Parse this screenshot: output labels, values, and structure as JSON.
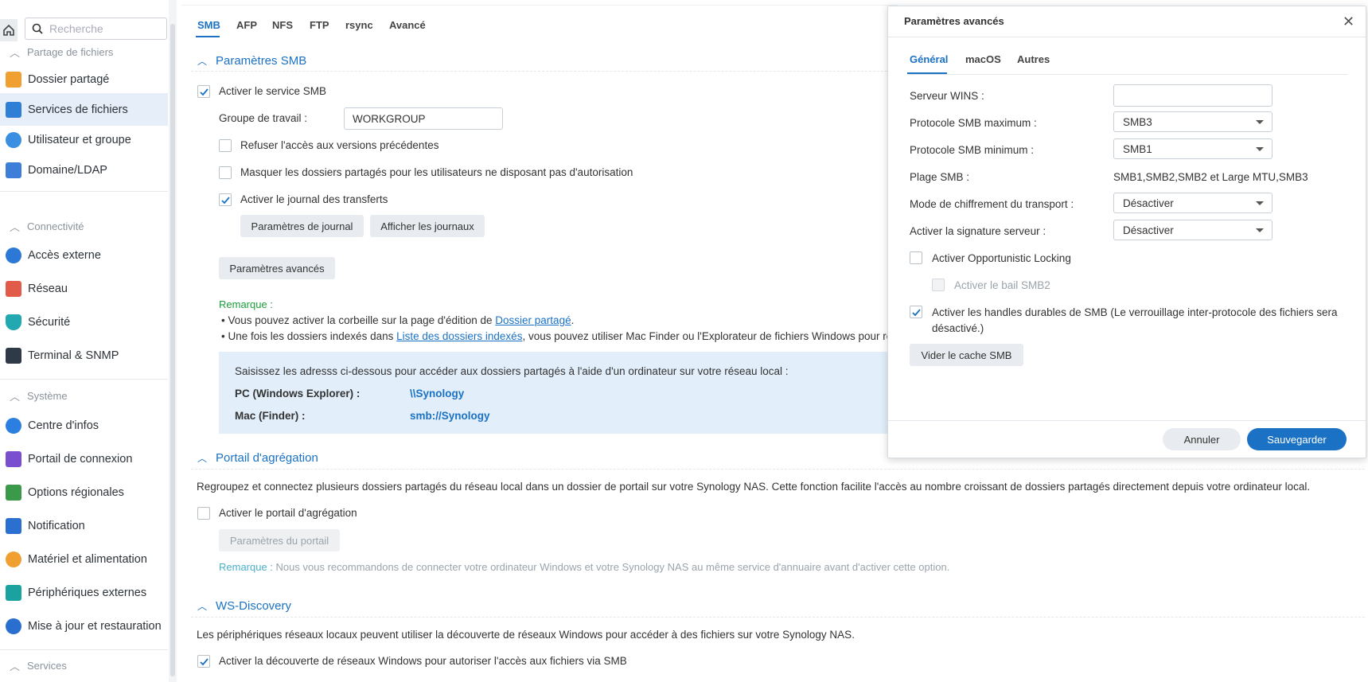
{
  "sidebar": {
    "search_placeholder": "Recherche",
    "sections": {
      "partage": "Partage de fichiers",
      "connectivite": "Connectivité",
      "systeme": "Système",
      "services": "Services"
    },
    "items": [
      {
        "label": "Dossier partagé",
        "icon": "shared-folder-icon",
        "color": "#f0a030"
      },
      {
        "label": "Services de fichiers",
        "icon": "file-services-icon",
        "color": "#2f7fd6"
      },
      {
        "label": "Utilisateur et groupe",
        "icon": "user-group-icon",
        "color": "#3a8fe0"
      },
      {
        "label": "Domaine/LDAP",
        "icon": "domain-ldap-icon",
        "color": "#3f7ed8"
      },
      {
        "label": "Accès externe",
        "icon": "external-access-icon",
        "color": "#2c78d6"
      },
      {
        "label": "Réseau",
        "icon": "network-icon",
        "color": "#e25a4a"
      },
      {
        "label": "Sécurité",
        "icon": "security-shield-icon",
        "color": "#22a8b0"
      },
      {
        "label": "Terminal & SNMP",
        "icon": "terminal-icon",
        "color": "#2f3a49"
      },
      {
        "label": "Centre d'infos",
        "icon": "info-center-icon",
        "color": "#2b7fe0"
      },
      {
        "label": "Portail de connexion",
        "icon": "login-portal-icon",
        "color": "#7a4fcf"
      },
      {
        "label": "Options régionales",
        "icon": "regional-options-icon",
        "color": "#3a9a4a"
      },
      {
        "label": "Notification",
        "icon": "notification-icon",
        "color": "#2b6fd0"
      },
      {
        "label": "Matériel et alimentation",
        "icon": "hardware-power-icon",
        "color": "#f0a030"
      },
      {
        "label": "Périphériques externes",
        "icon": "external-devices-icon",
        "color": "#1aa2a0"
      },
      {
        "label": "Mise à jour et restauration",
        "icon": "update-restore-icon",
        "color": "#2a6fcf"
      }
    ]
  },
  "tabs": [
    "SMB",
    "AFP",
    "NFS",
    "FTP",
    "rsync",
    "Avancé"
  ],
  "smb": {
    "header": "Paramètres SMB",
    "enable_service": "Activer le service SMB",
    "workgroup_label": "Groupe de travail :",
    "workgroup_value": "WORKGROUP",
    "deny_previous": "Refuser l'accès aux versions précédentes",
    "hide_shares": "Masquer les dossiers partagés pour les utilisateurs ne disposant pas d'autorisation",
    "enable_log": "Activer le journal des transferts",
    "log_settings_btn": "Paramètres de journal",
    "view_logs_btn": "Afficher les journaux",
    "advanced_btn": "Paramètres avancés",
    "note_label": "Remarque :",
    "note1_pre": "Vous pouvez activer la corbeille sur la page d'édition de ",
    "note1_link": "Dossier partagé",
    "note1_post": ".",
    "note2_pre": "Une fois les dossiers indexés dans ",
    "note2_link": "Liste des dossiers indexés",
    "note2_post": ", vous pouvez utiliser Mac Finder ou l'Explorateur de fichiers Windows pour reche",
    "info_text": "Saisissez les adresss ci-dessous pour accéder aux dossiers partagés à l'aide d'un ordinateur sur votre réseau local :",
    "pc_label": "PC (Windows Explorer) :",
    "pc_value": "\\\\Synology",
    "mac_label": "Mac (Finder) :",
    "mac_value": "smb://Synology"
  },
  "aggregation": {
    "header": "Portail d'agrégation",
    "description": "Regroupez et connectez plusieurs dossiers partagés du réseau local dans un dossier de portail sur votre Synology NAS. Cette fonction facilite l'accès au nombre croissant de dossiers partagés directement depuis votre ordinateur local.",
    "enable": "Activer le portail d'agrégation",
    "portal_btn": "Paramètres du portail",
    "note_label": "Remarque :",
    "note_text": "Nous vous recommandons de connecter votre ordinateur Windows et votre Synology NAS au même service d'annuaire avant d'activer cette option."
  },
  "wsd": {
    "header": "WS-Discovery",
    "description": "Les périphériques réseaux locaux peuvent utiliser la découverte de réseaux Windows pour accéder à des fichiers sur votre Synology NAS.",
    "enable": "Activer la découverte de réseaux Windows pour autoriser l'accès aux fichiers via SMB"
  },
  "dialog": {
    "title": "Paramètres avancés",
    "tabs": [
      "Général",
      "macOS",
      "Autres"
    ],
    "wins_label": "Serveur WINS :",
    "wins_value": "",
    "max_label": "Protocole SMB maximum :",
    "max_value": "SMB3",
    "min_label": "Protocole SMB minimum :",
    "min_value": "SMB1",
    "range_label": "Plage SMB :",
    "range_value": "SMB1,SMB2,SMB2 et Large MTU,SMB3",
    "encrypt_label": "Mode de chiffrement du transport :",
    "encrypt_value": "Désactiver",
    "signing_label": "Activer la signature serveur :",
    "signing_value": "Désactiver",
    "oplock": "Activer Opportunistic Locking",
    "lease": "Activer le bail SMB2",
    "durable_line1": "Activer les handles durables de SMB (Le verrouillage inter-protocole des fichiers sera",
    "durable_line2": "désactivé.)",
    "clear_cache_btn": "Vider le cache SMB",
    "cancel_btn": "Annuler",
    "save_btn": "Sauvegarder"
  },
  "colors": {
    "accent": "#1b72c4",
    "note_green": "#1b9e3a",
    "note_teal": "#4ab0c8"
  }
}
